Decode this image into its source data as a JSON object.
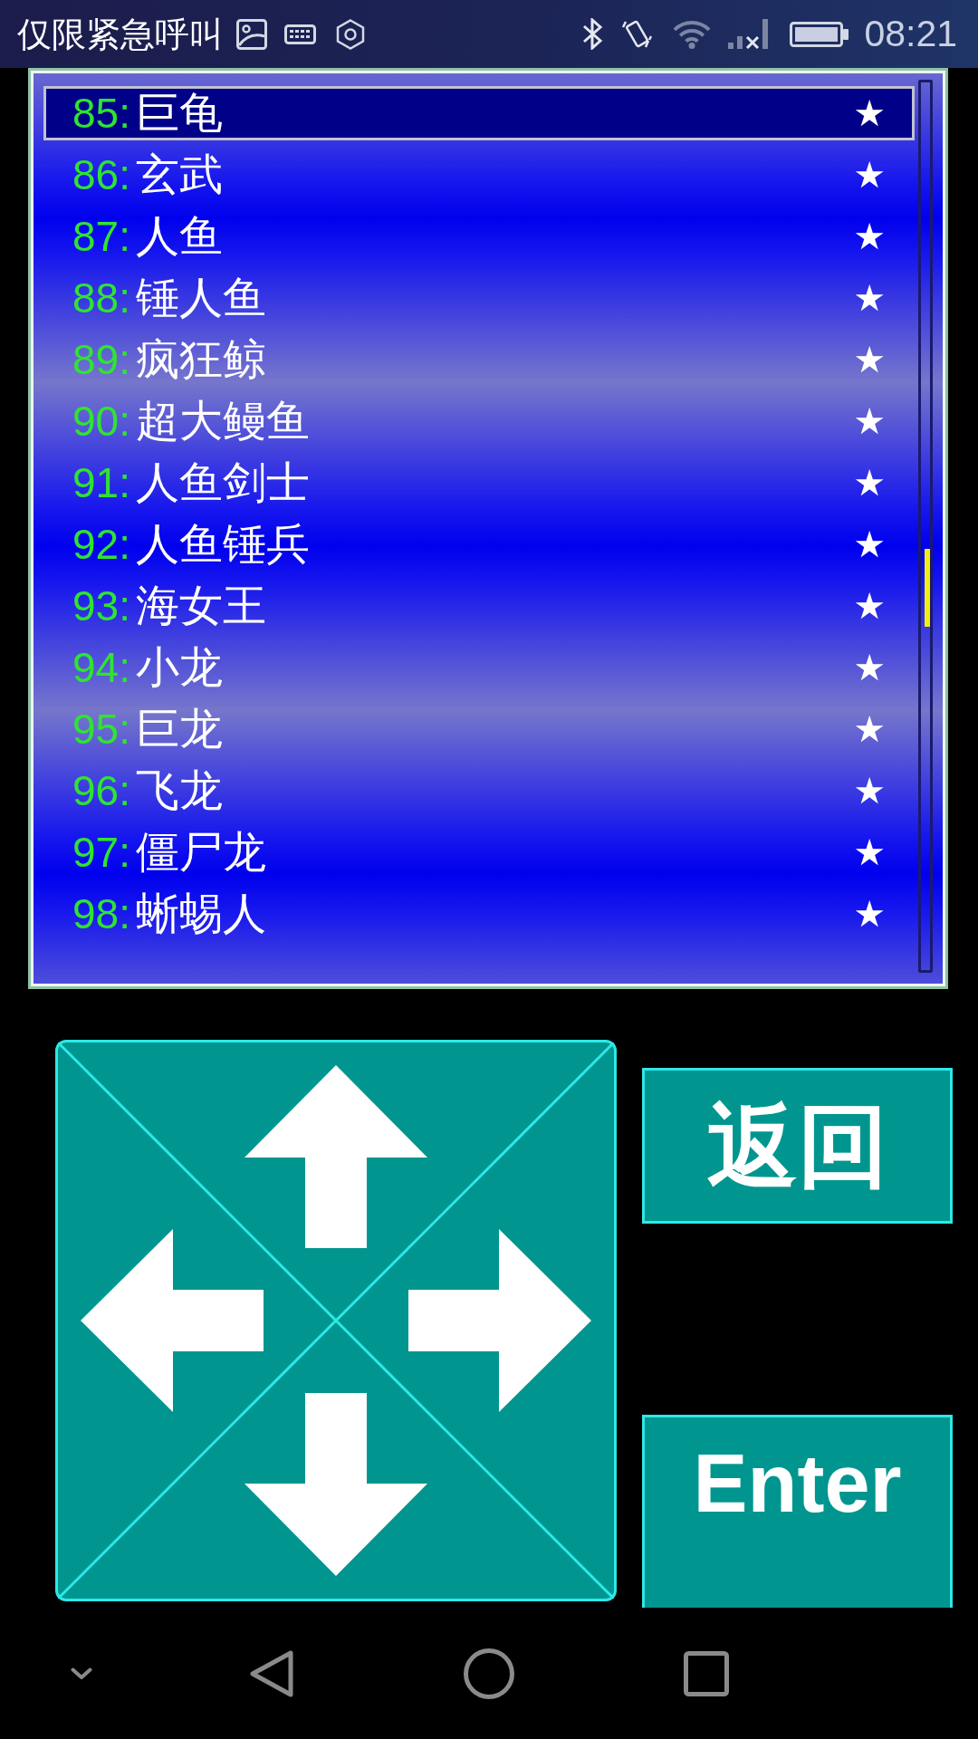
{
  "status_bar": {
    "carrier_text": "仅限紧急呼叫",
    "time": "08:21"
  },
  "list": {
    "items": [
      {
        "number": "85:",
        "name": "巨龟",
        "mark": "★",
        "selected": true
      },
      {
        "number": "86:",
        "name": "玄武",
        "mark": "★",
        "selected": false
      },
      {
        "number": "87:",
        "name": "人鱼",
        "mark": "★",
        "selected": false
      },
      {
        "number": "88:",
        "name": "锤人鱼",
        "mark": "★",
        "selected": false
      },
      {
        "number": "89:",
        "name": "疯狂鲸",
        "mark": "★",
        "selected": false
      },
      {
        "number": "90:",
        "name": "超大鳗鱼",
        "mark": "★",
        "selected": false
      },
      {
        "number": "91:",
        "name": "人鱼剑士",
        "mark": "★",
        "selected": false
      },
      {
        "number": "92:",
        "name": "人鱼锤兵",
        "mark": "★",
        "selected": false
      },
      {
        "number": "93:",
        "name": "海女王",
        "mark": "★",
        "selected": false
      },
      {
        "number": "94:",
        "name": "小龙",
        "mark": "★",
        "selected": false
      },
      {
        "number": "95:",
        "name": "巨龙",
        "mark": "★",
        "selected": false
      },
      {
        "number": "96:",
        "name": "飞龙",
        "mark": "★",
        "selected": false
      },
      {
        "number": "97:",
        "name": "僵尸龙",
        "mark": "★",
        "selected": false
      },
      {
        "number": "98:",
        "name": "蜥蜴人",
        "mark": "★",
        "selected": false
      }
    ]
  },
  "buttons": [
    {
      "label": "返回"
    },
    {
      "label": "Enter"
    }
  ]
}
